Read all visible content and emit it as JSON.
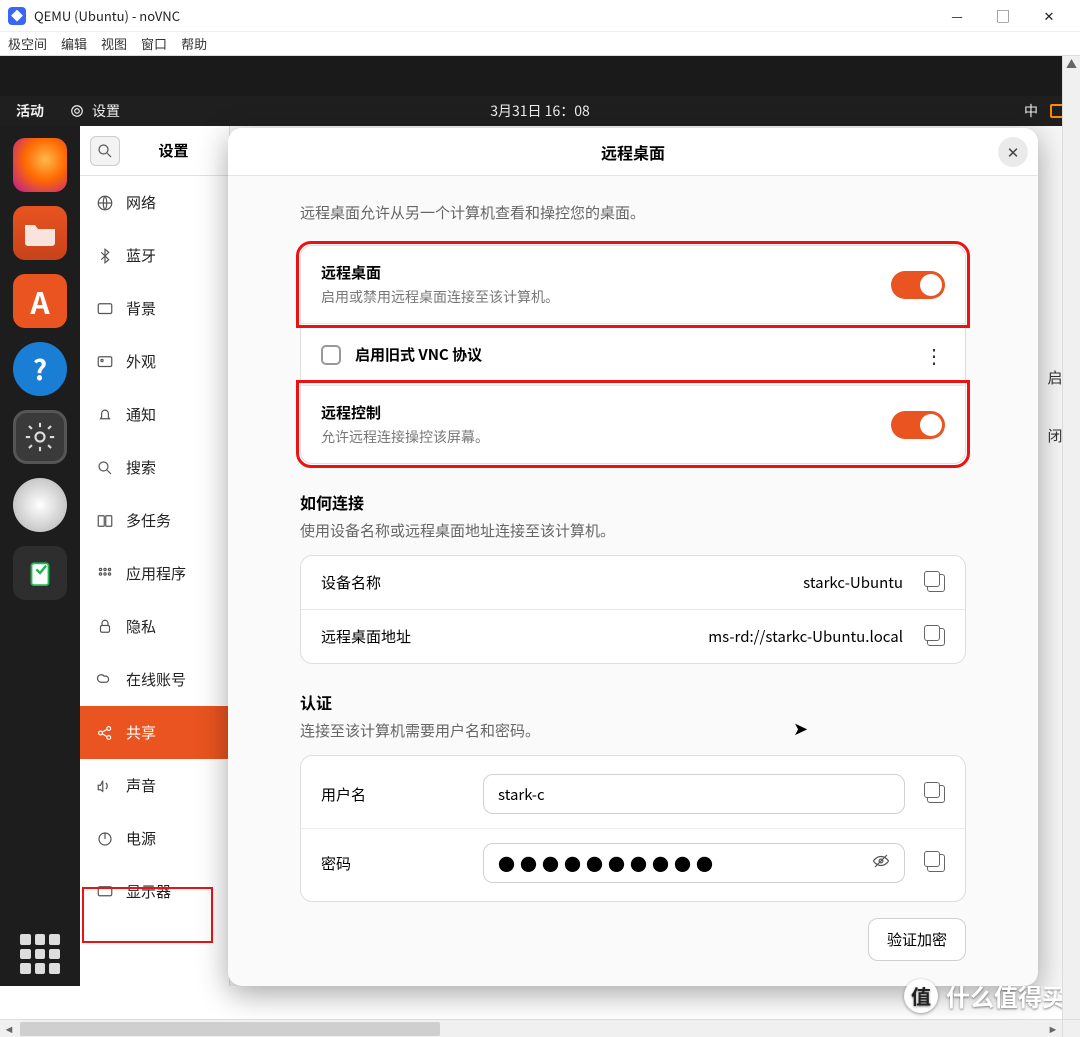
{
  "window": {
    "title": "QEMU (Ubuntu) - noVNC",
    "menubar": [
      "极空间",
      "编辑",
      "视图",
      "窗口",
      "帮助"
    ]
  },
  "gnome": {
    "activities": "活动",
    "app_label": "设置",
    "clock": "3月31日  16：08",
    "ime": "中"
  },
  "dock": {
    "items": [
      "firefox",
      "files",
      "store",
      "help",
      "settings",
      "disc",
      "trash"
    ]
  },
  "settings": {
    "sidebar_title": "设置",
    "sidebar": [
      {
        "key": "network",
        "label": "网络"
      },
      {
        "key": "bluetooth",
        "label": "蓝牙"
      },
      {
        "key": "background",
        "label": "背景"
      },
      {
        "key": "appearance",
        "label": "外观"
      },
      {
        "key": "notifications",
        "label": "通知"
      },
      {
        "key": "search",
        "label": "搜索"
      },
      {
        "key": "multitask",
        "label": "多任务"
      },
      {
        "key": "apps",
        "label": "应用程序"
      },
      {
        "key": "privacy",
        "label": "隐私"
      },
      {
        "key": "online",
        "label": "在线账号"
      },
      {
        "key": "sharing",
        "label": "共享",
        "selected": true
      },
      {
        "key": "sound",
        "label": "声音"
      },
      {
        "key": "power",
        "label": "电源"
      },
      {
        "key": "display",
        "label": "显示器"
      }
    ],
    "bg_hints": {
      "a": "启",
      "b": "闭"
    }
  },
  "dialog": {
    "title": "远程桌面",
    "intro": "远程桌面允许从另一个计算机查看和操控您的桌面。",
    "remote_desktop": {
      "title": "远程桌面",
      "desc": "启用或禁用远程桌面连接至该计算机。",
      "on": true
    },
    "legacy_vnc": {
      "label": "启用旧式 VNC 协议",
      "checked": false
    },
    "remote_control": {
      "title": "远程控制",
      "desc": "允许远程连接操控该屏幕。",
      "on": true
    },
    "howto": {
      "title": "如何连接",
      "desc": "使用设备名称或远程桌面地址连接至该计算机。"
    },
    "device_name": {
      "label": "设备名称",
      "value": "starkc-Ubuntu"
    },
    "rd_address": {
      "label": "远程桌面地址",
      "value": "ms-rd://starkc-Ubuntu.local"
    },
    "auth": {
      "title": "认证",
      "desc": "连接至该计算机需要用户名和密码。"
    },
    "username": {
      "label": "用户名",
      "value": "stark-c"
    },
    "password": {
      "label": "密码",
      "value": "●●●●●●●●●●"
    },
    "verify_btn": "验证加密"
  },
  "watermark": "什么值得买"
}
